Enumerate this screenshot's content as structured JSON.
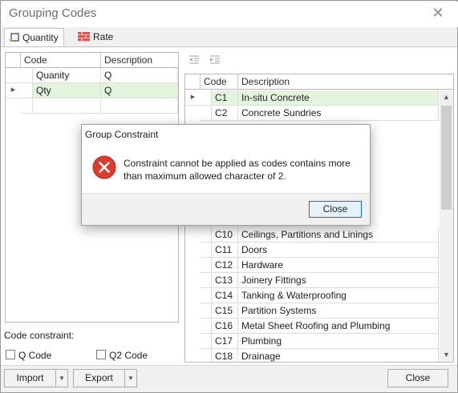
{
  "window": {
    "title": "Grouping Codes"
  },
  "tabs": [
    {
      "label": "Quantity",
      "icon": "quantity-tab-icon"
    },
    {
      "label": "Rate",
      "icon": "rate-tab-icon"
    }
  ],
  "left_grid": {
    "columns": [
      "Code",
      "Description"
    ],
    "rows": [
      {
        "code": "Quanity",
        "description": "Q"
      },
      {
        "code": "Qty",
        "description": "Q"
      }
    ]
  },
  "code_constraint": {
    "label": "Code constraint:",
    "options": [
      "Q Code",
      "Q2 Code"
    ]
  },
  "right_grid": {
    "columns": [
      "Code",
      "Description"
    ],
    "rows": [
      {
        "code": "C1",
        "description": "In-situ Concrete"
      },
      {
        "code": "C2",
        "description": "Concrete Sundries"
      },
      {
        "code": "C10",
        "description": "Ceilings, Partitions and Linings"
      },
      {
        "code": "C11",
        "description": "Doors"
      },
      {
        "code": "C12",
        "description": "Hardware"
      },
      {
        "code": "C13",
        "description": "Joinery Fittings"
      },
      {
        "code": "C14",
        "description": "Tanking & Waterproofing"
      },
      {
        "code": "C15",
        "description": "Partition Systems"
      },
      {
        "code": "C16",
        "description": "Metal Sheet Roofing and Plumbing"
      },
      {
        "code": "C17",
        "description": "Plumbing"
      },
      {
        "code": "C18",
        "description": "Drainage"
      }
    ]
  },
  "footer": {
    "import_label": "Import",
    "export_label": "Export",
    "close_label": "Close"
  },
  "dialog": {
    "title": "Group Constraint",
    "message_line1": "Constraint cannot be applied as codes contains more",
    "message_line2": "than maximum allowed character of 2.",
    "close_label": "Close",
    "icon": "error-icon"
  },
  "colors": {
    "selected_row": "#e2f4dc",
    "error_red": "#e03a2f",
    "dialog_border": "#7ea4d6"
  }
}
